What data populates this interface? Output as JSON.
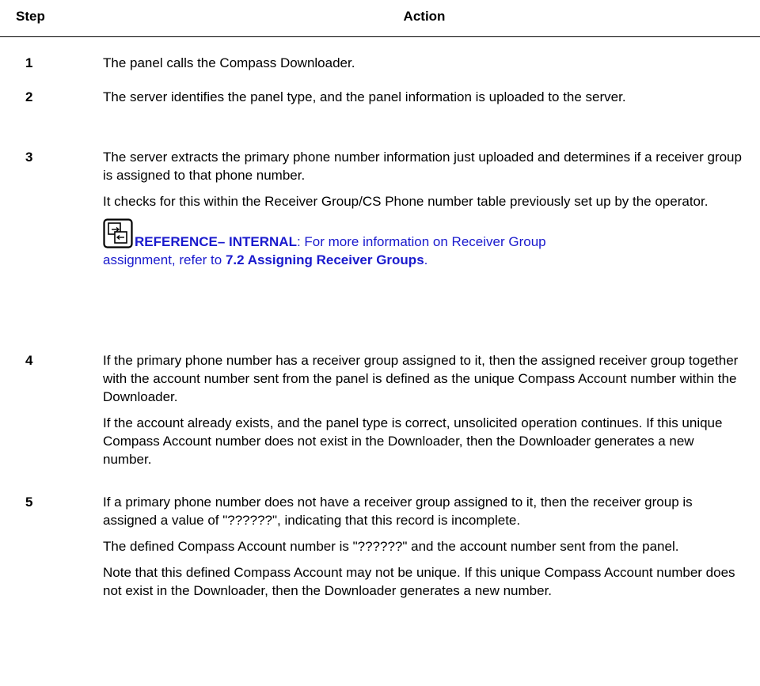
{
  "header": {
    "step_label": "Step",
    "action_label": "Action"
  },
  "steps": [
    {
      "num": "1",
      "paras": [
        "The panel calls the Compass Downloader."
      ]
    },
    {
      "num": "2",
      "paras": [
        "The server identifies the panel type, and the panel information is uploaded to the server."
      ]
    },
    {
      "num": "3",
      "paras": [
        "The server extracts the primary phone number information just uploaded and determines if a receiver group is assigned to that phone number.",
        "It checks for this within the Receiver Group/CS Phone number table previously set up by the operator."
      ],
      "reference": {
        "icon": "reference-icon",
        "label": "REFERENCE– INTERNAL",
        "sep": ":",
        "text_a": " For more information on Receiver Group",
        "text_b": "assignment, refer to ",
        "link": "7.2 Assigning Receiver Groups",
        "end": ".",
        "color": "#1a1acd"
      }
    },
    {
      "num": "4",
      "paras": [
        "If the primary phone number has a receiver group assigned to it, then the assigned receiver group together with the account number sent from the panel is defined as the unique Compass Account number within the Downloader.",
        "If the account already exists, and the panel type is correct, unsolicited operation continues. If this unique Compass Account number does not exist in the Downloader, then the Downloader generates a new number."
      ]
    },
    {
      "num": "5",
      "paras": [
        "If a primary phone number does not have a receiver group assigned to it, then the receiver group is assigned a value of \"??????\", indicating that this record is incomplete.",
        "The defined Compass Account number is \"??????\" and the account number sent from the panel.",
        "Note that this defined Compass Account may not be unique. If this unique Compass Account number does not exist in the Downloader, then the Downloader generates a new number."
      ]
    }
  ]
}
